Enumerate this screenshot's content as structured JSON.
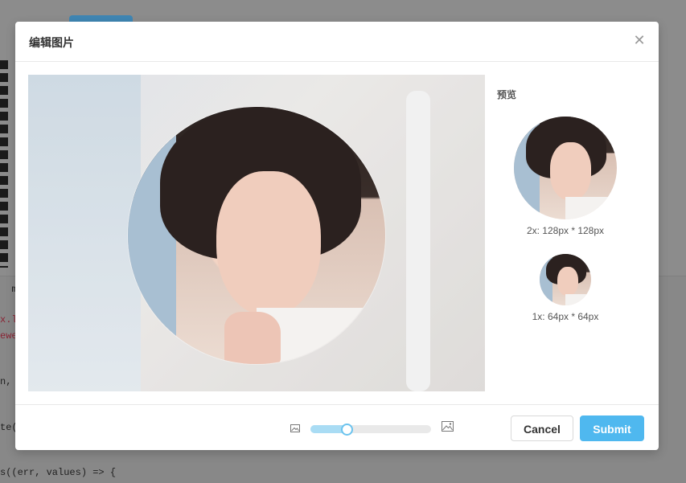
{
  "background": {
    "code_lines": [
      {
        "text": "  mo",
        "red": false
      },
      {
        "text": "x.l",
        "red": true
      },
      {
        "text": "ewe",
        "red": true
      },
      {
        "text": "n,",
        "red": false
      },
      {
        "text": "te(",
        "red": false
      },
      {
        "text": "s((err, values) => {",
        "red": false
      }
    ]
  },
  "modal": {
    "title": "编辑图片",
    "close_icon": "close-icon",
    "preview": {
      "title": "预览",
      "large_caption": "2x: 128px * 128px",
      "small_caption": "1x: 64px * 64px"
    },
    "footer": {
      "zoom_level": 0.3,
      "zoom_out_icon": "image-small-icon",
      "zoom_in_icon": "image-large-icon",
      "cancel_label": "Cancel",
      "submit_label": "Submit"
    }
  },
  "colors": {
    "primary": "#4fb8ef",
    "slider_fill": "#a9dcf4",
    "slider_handle_border": "#6bc3ee"
  }
}
